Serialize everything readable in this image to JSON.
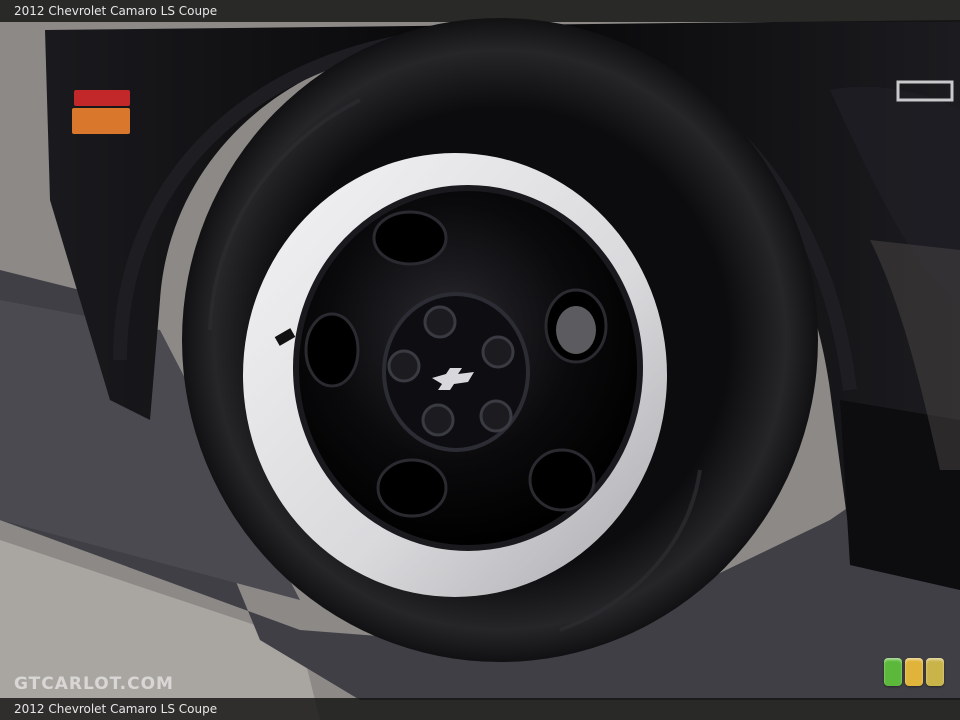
{
  "caption": {
    "top": "2012 Chevrolet Camaro LS Coupe",
    "bottom": "2012 Chevrolet Camaro LS Coupe"
  },
  "watermark": {
    "text": "GTCARLOT.COM"
  },
  "badge": {
    "colors": [
      "#5cb83a",
      "#e0b43a",
      "#c9b44a"
    ]
  },
  "colors": {
    "car_body": "#0b0b0d",
    "tire": "#151517",
    "wheel": "#0a0a0c",
    "rim_lip": "#e9e9eb",
    "pavement": "#8a8784",
    "shadow": "#3f3f45"
  }
}
